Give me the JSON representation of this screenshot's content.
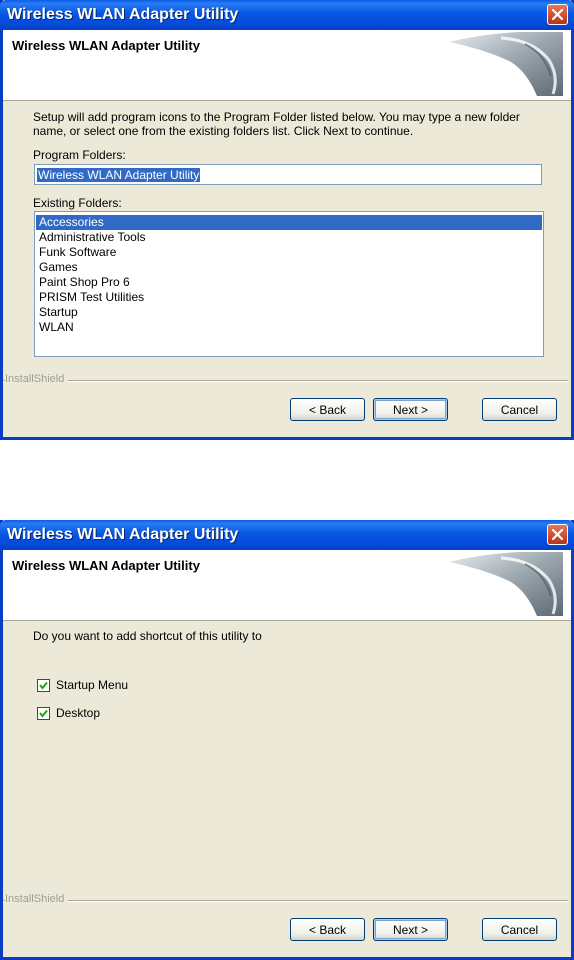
{
  "colors": {
    "titlebar": "#0a5fe8",
    "selection": "#316ac5",
    "dialog_bg": "#ece9d8"
  },
  "window1": {
    "title": "Wireless WLAN Adapter Utility",
    "header_title": "Wireless WLAN Adapter Utility",
    "instructions_line1": "Setup will add program icons to the Program Folder listed below.  You may type a new folder",
    "instructions_line2": "name, or select one from the existing folders list.  Click Next to continue.",
    "program_folders_label": "Program Folders:",
    "program_folder_value": "Wireless WLAN Adapter Utility",
    "existing_folders_label": "Existing Folders:",
    "existing_folders": [
      "Accessories",
      "Administrative Tools",
      "Funk Software",
      "Games",
      "Paint Shop Pro 6",
      "PRISM Test Utilities",
      "Startup",
      "WLAN"
    ],
    "selected_folder": "Accessories",
    "brand": "InstallShield",
    "back_label": "< Back",
    "next_label": "Next >",
    "cancel_label": "Cancel"
  },
  "window2": {
    "title": "Wireless WLAN Adapter Utility",
    "header_title": "Wireless WLAN Adapter Utility",
    "question": "Do you want to add shortcut of this utility to",
    "option_startup_menu": "Startup Menu",
    "option_startup_menu_checked": true,
    "option_desktop": "Desktop",
    "option_desktop_checked": true,
    "brand": "InstallShield",
    "back_label": "< Back",
    "next_label": "Next >",
    "cancel_label": "Cancel"
  }
}
